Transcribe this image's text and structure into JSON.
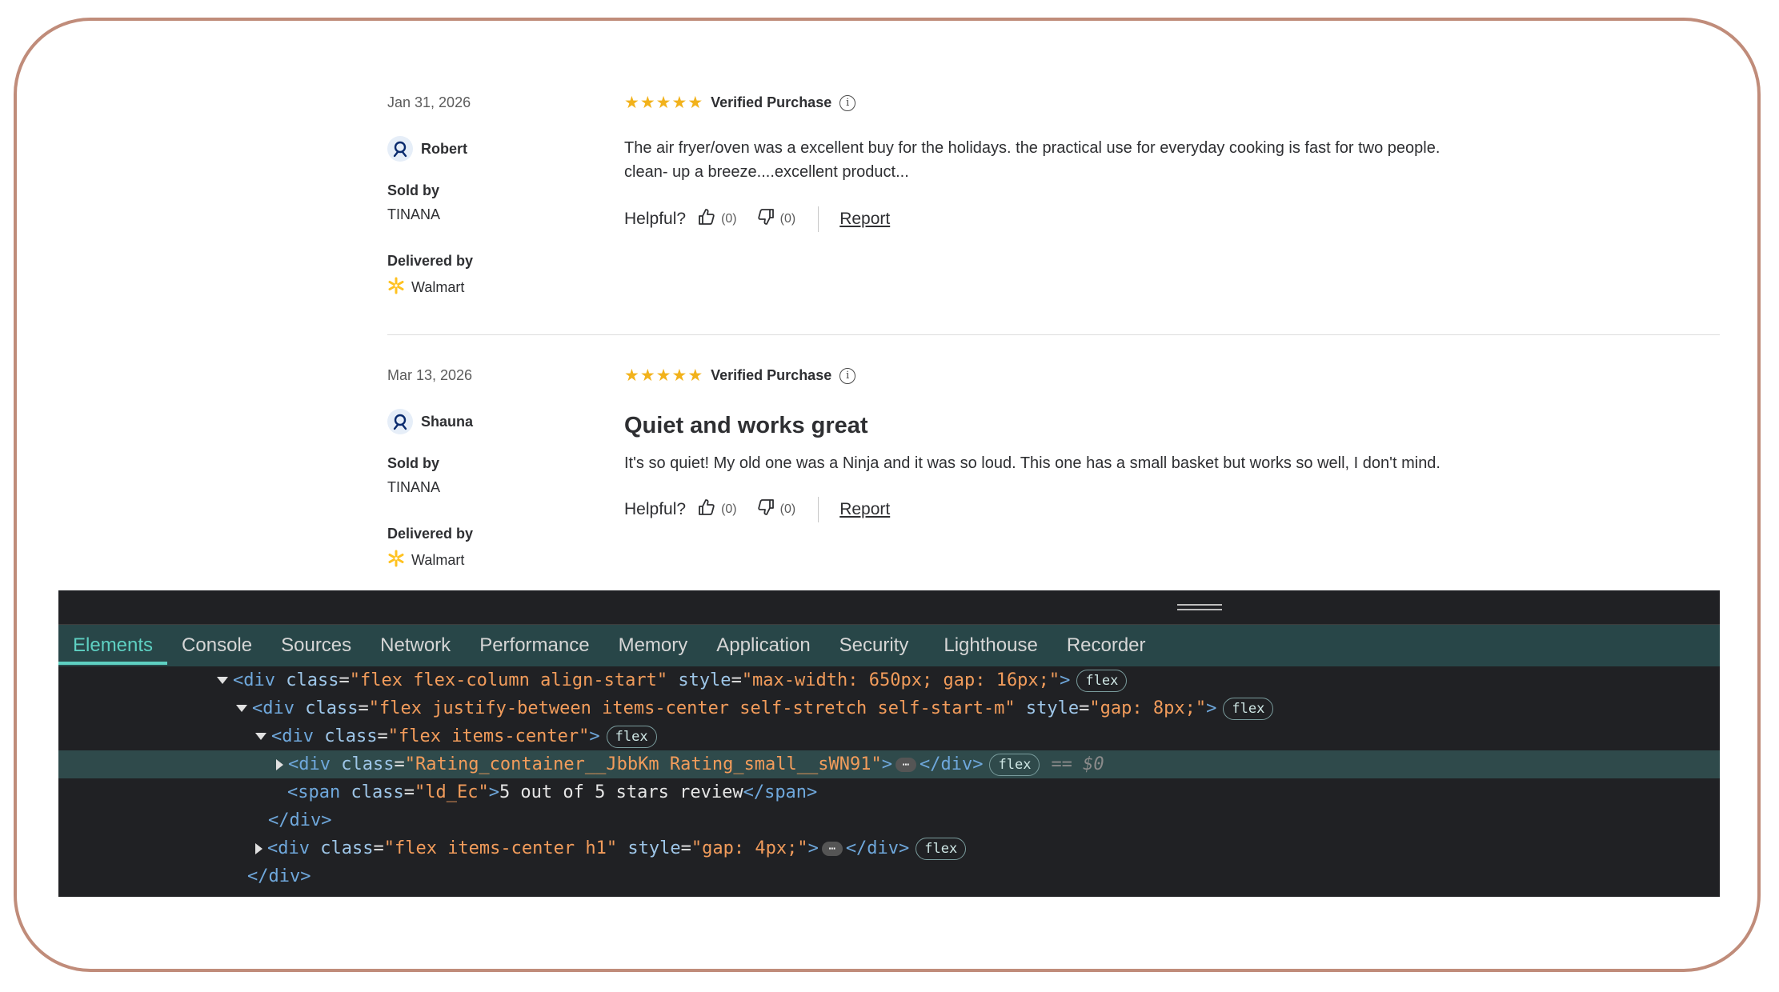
{
  "reviews": [
    {
      "date": "Jan 31, 2026",
      "reviewer": "Robert",
      "rating": 5,
      "verified_label": "Verified Purchase",
      "title": "",
      "body_lines": [
        "The air fryer/oven was a excellent buy for the holidays. the practical use for everyday cooking is fast for two people.",
        "clean- up a breeze....excellent product..."
      ],
      "sold_by_label": "Sold by",
      "sold_by": "TINANA",
      "delivered_by_label": "Delivered by",
      "delivered_by": "Walmart",
      "helpful_label": "Helpful?",
      "upvotes": "(0)",
      "downvotes": "(0)",
      "report_label": "Report"
    },
    {
      "date": "Mar 13, 2026",
      "reviewer": "Shauna",
      "rating": 5,
      "verified_label": "Verified Purchase",
      "title": "Quiet and works great",
      "body_lines": [
        "It's so quiet! My old one was a Ninja and it was so loud. This one has a small basket but works so well, I don't mind."
      ],
      "sold_by_label": "Sold by",
      "sold_by": "TINANA",
      "delivered_by_label": "Delivered by",
      "delivered_by": "Walmart",
      "helpful_label": "Helpful?",
      "upvotes": "(0)",
      "downvotes": "(0)",
      "report_label": "Report"
    }
  ],
  "colors": {
    "star": "#f2b21b",
    "walmart_spark": "#ffc220",
    "devtools_bg": "#202124",
    "devtools_tabbar": "#284648",
    "active_tab": "#5ed0c2"
  },
  "devtools": {
    "tabs": [
      "Elements",
      "Console",
      "Sources",
      "Network",
      "Performance",
      "Memory",
      "Application",
      "Security",
      "Lighthouse",
      "Recorder"
    ],
    "active_tab": "Elements",
    "lines": [
      {
        "open": "<div ",
        "a1": "class",
        "eq1": "=",
        "v1": "\"flex flex-column align-start\"",
        "a2": " style",
        "eq2": "=",
        "v2": "\"max-width: 650px; gap: 16px;\"",
        "close": ">",
        "badge": "flex"
      },
      {
        "open": "<div ",
        "a1": "class",
        "eq1": "=",
        "v1": "\"flex justify-between items-center self-stretch self-start-m\"",
        "a2": " style",
        "eq2": "=",
        "v2": "\"gap: 8px;\"",
        "close": ">",
        "badge": "flex"
      },
      {
        "open": "<div ",
        "a1": "class",
        "eq1": "=",
        "v1": "\"flex items-center\"",
        "close": ">",
        "badge": "flex"
      },
      {
        "open": "<div ",
        "a1": "class",
        "eq1": "=",
        "v1": "\"Rating_container__JbbKm Rating_small__sWN91\"",
        "close": ">",
        "dots": "⋯",
        "end": "</div>",
        "badge": "flex",
        "dollar": "== $0"
      },
      {
        "open": "<span ",
        "a1": "class",
        "eq1": "=",
        "v1": "\"ld_Ec\"",
        "close": ">",
        "text": "5 out of 5 stars review",
        "end": "</span>"
      },
      {
        "end_only": "</div>"
      },
      {
        "open": "<div ",
        "a1": "class",
        "eq1": "=",
        "v1": "\"flex items-center h1\"",
        "a2": " style",
        "eq2": "=",
        "v2": "\"gap: 4px;\"",
        "close": ">",
        "dots": "⋯",
        "end": "</div>",
        "badge": "flex"
      },
      {
        "end_only": "</div>"
      }
    ]
  }
}
